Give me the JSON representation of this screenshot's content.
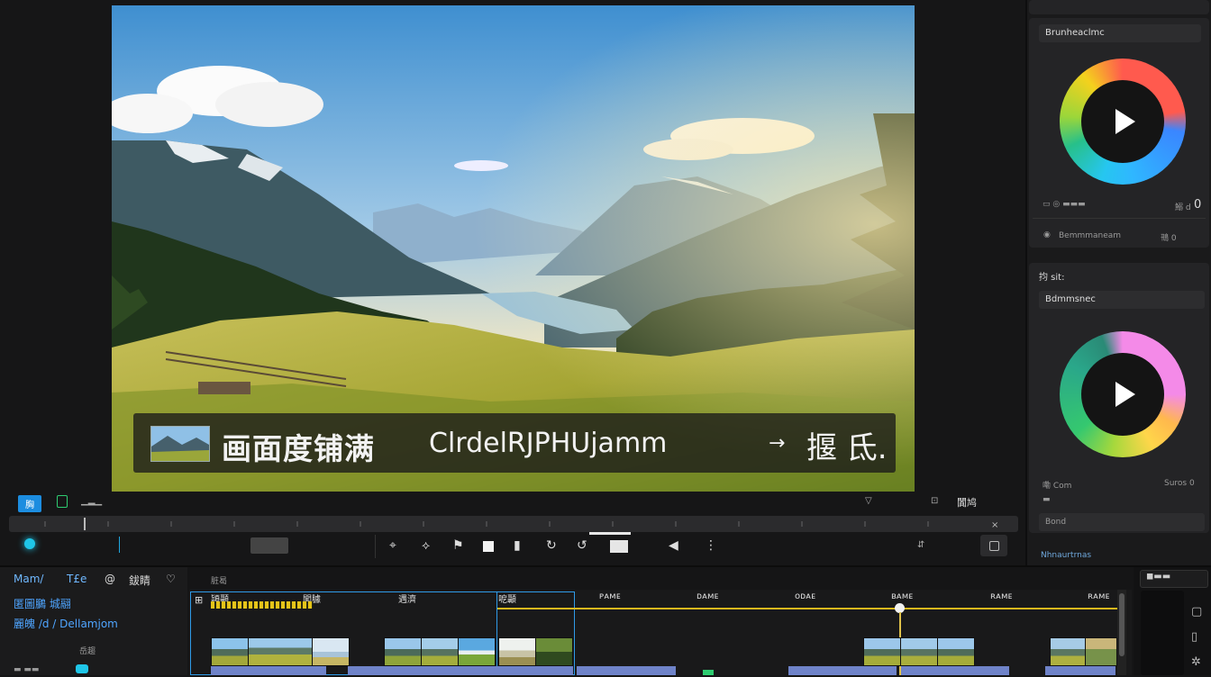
{
  "preview": {
    "caption_chinese": "画面度铺满",
    "caption_latin": "ClrdelRJPHUjamm",
    "caption_arrow": "→",
    "caption_tail": "揠 氐.",
    "colors": {
      "caption_bg": "#1c1c1c",
      "accent": "#1c8de0"
    }
  },
  "transport": {
    "chip_label": "胸",
    "right_label": "闐鸠"
  },
  "right_panel": {
    "card1_title": "Brunheaclmc",
    "card1_footer_value": "0",
    "card1_footer_small": "鰯 d",
    "card1_link": "Bemmmaneam",
    "card1_link_right": "鳵 0",
    "card2_header": "抣 sit:",
    "card2_title": "Bdmmsnec",
    "card2_footer_left": "嘞 Com",
    "card2_footer_right": "Suros 0",
    "card2_field": "Bond",
    "bottom_label": "Nhnaurtrnas"
  },
  "bottom": {
    "tabs": [
      "Mam/",
      "T£e",
      "@",
      "鈸睛",
      "♡"
    ],
    "breadcrumb": "脏曷",
    "left_line1": "匿圖鵩 城翮",
    "left_line2": "麗魄 /d / Dellamjom",
    "left_small": "岳趨",
    "timeline_labels": [
      "頴顳",
      "闖臄",
      "遇濟",
      "呝顳",
      "ᴘᴀᴍᴇ",
      "ᴅᴀᴍᴇ",
      "ᴏᴅᴀᴇ",
      "ʙᴀᴍᴇ",
      "ʀᴀᴍᴇ",
      "ʀᴀᴍᴇ"
    ]
  }
}
